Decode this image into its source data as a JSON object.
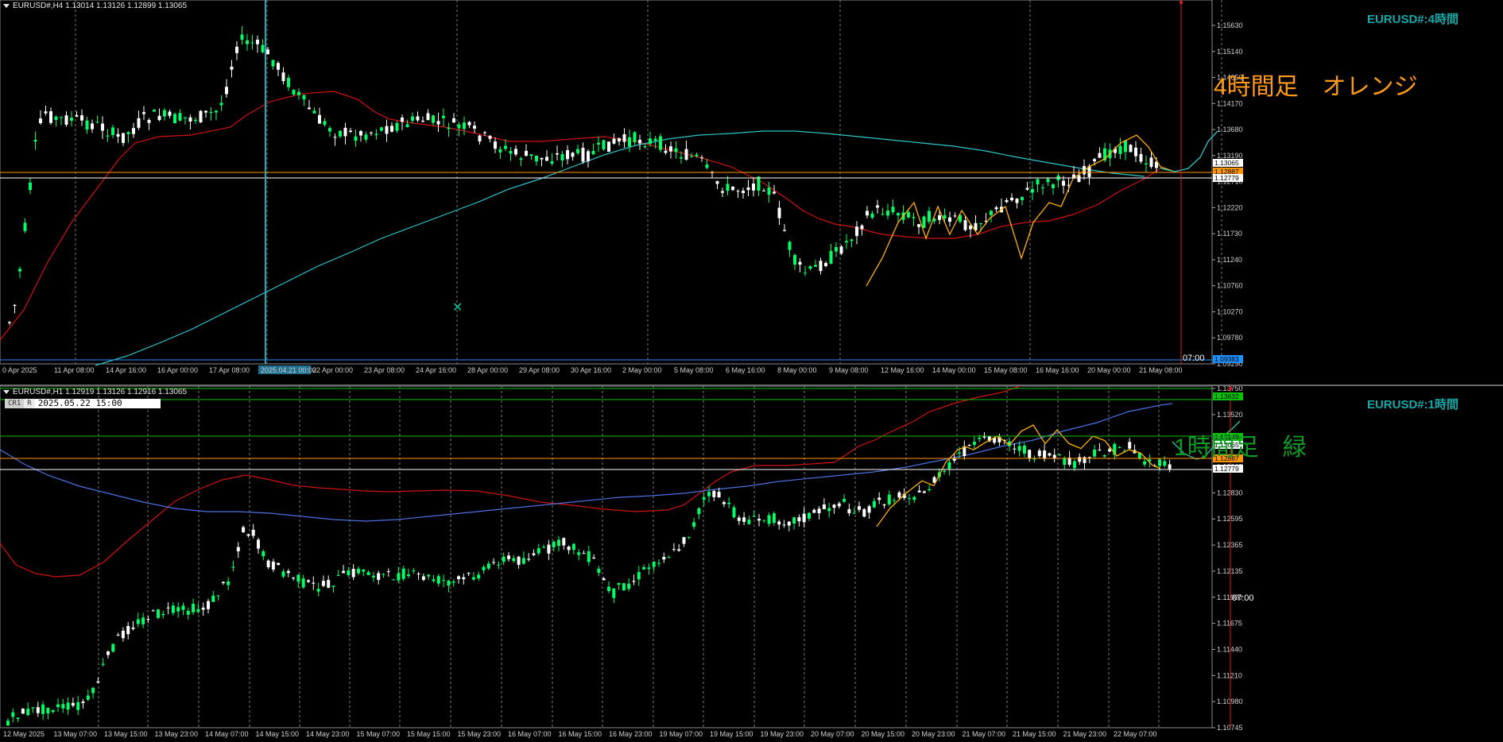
{
  "colors": {
    "bg": "#000000",
    "bull": "#00ff66",
    "bear": "#ffffff",
    "ma_red": "#d11212",
    "ma_cyan": "#2ec7c7",
    "ma_blue": "#4d6fe0",
    "zigzag": "#ffb000",
    "hline_orange": "#ff9500",
    "hline_white": "#ffffff",
    "hline_green": "#0bc20b",
    "vline_red": "#e01b1b",
    "grid": "#7a7a7a",
    "axis_text": "#d0d0d0"
  },
  "pane1": {
    "header": "EURUSD#,H4  1.13014 1.13126 1.12899 1.13065",
    "watermark": "EURUSD#:4時間",
    "annotation": "4時間足　オレンジ",
    "annotation_color": "#ff9a1a",
    "marker_time": "07:00",
    "y_ticks": [
      "1.15630",
      "1.15140",
      "1.14650",
      "1.14170",
      "1.13680",
      "1.13190",
      "1.12710",
      "1.12220",
      "1.11730",
      "1.11240",
      "1.10760",
      "1.10270",
      "1.09780",
      "1.09290"
    ],
    "price_labels": [
      {
        "text": "1.13065",
        "bg": "#ffffff",
        "fg": "#000000"
      },
      {
        "text": "1.12887",
        "bg": "#ff9500",
        "fg": "#000000"
      },
      {
        "text": "1.12779",
        "bg": "#ffffff",
        "fg": "#000000"
      },
      {
        "text": "1.09383",
        "bg": "#1e90ff",
        "fg": "#000000"
      }
    ],
    "x_labels": [
      "0 Apr 2025",
      "11 Apr 08:00",
      "14 Apr 16:00",
      "16 Apr 00:00",
      "17 Apr 08:00",
      "2025.04.21 00:00",
      "22 Apr 00:00",
      "23 Apr 08:00",
      "24 Apr 16:00",
      "28 Apr 00:00",
      "29 Apr 08:00",
      "30 Apr 16:00",
      "2 May 00:00",
      "5 May 08:00",
      "6 May 16:00",
      "8 May 00:00",
      "9 May 08:00",
      "12 May 16:00",
      "14 May 00:00",
      "15 May 08:00",
      "16 May 16:00",
      "20 May 00:00",
      "21 May 08:00"
    ]
  },
  "pane2": {
    "header": "EURUSD#,H1  1.12919 1.13126 1.12916 1.13065",
    "badge_a": "CR1",
    "badge_b": "R",
    "badge_time": "2025.05.22 15:00",
    "watermark": "EURUSD#:1時間",
    "annotation": "1時間足　緑",
    "annotation_color": "#0f9a23",
    "marker_time": "07:00",
    "y_ticks": [
      "1.13750",
      "1.13520",
      "1.13290",
      "1.13065",
      "1.12830",
      "1.12595",
      "1.12365",
      "1.12135",
      "1.11900",
      "1.11675",
      "1.11440",
      "1.11210",
      "1.10980",
      "1.10745"
    ],
    "price_labels": [
      {
        "text": "1.13632",
        "bg": "#0bc20b",
        "fg": "#000000"
      },
      {
        "text": "1.13149",
        "bg": "#0bc20b",
        "fg": "#000000"
      },
      {
        "text": "1.13065",
        "bg": "#ffffff",
        "fg": "#000000"
      },
      {
        "text": "1.12887",
        "bg": "#ff9500",
        "fg": "#000000"
      },
      {
        "text": "1.12779",
        "bg": "#ffffff",
        "fg": "#000000"
      }
    ],
    "x_labels": [
      "12 May 2025",
      "13 May 07:00",
      "13 May 15:00",
      "13 May 23:00",
      "14 May 07:00",
      "14 May 15:00",
      "14 May 23:00",
      "15 May 07:00",
      "15 May 15:00",
      "15 May 23:00",
      "16 May 07:00",
      "16 May 15:00",
      "16 May 23:00",
      "19 May 07:00",
      "19 May 15:00",
      "19 May 23:00",
      "20 May 07:00",
      "20 May 15:00",
      "20 May 23:00",
      "21 May 07:00",
      "21 May 15:00",
      "21 May 23:00",
      "22 May 07:00"
    ]
  }
}
